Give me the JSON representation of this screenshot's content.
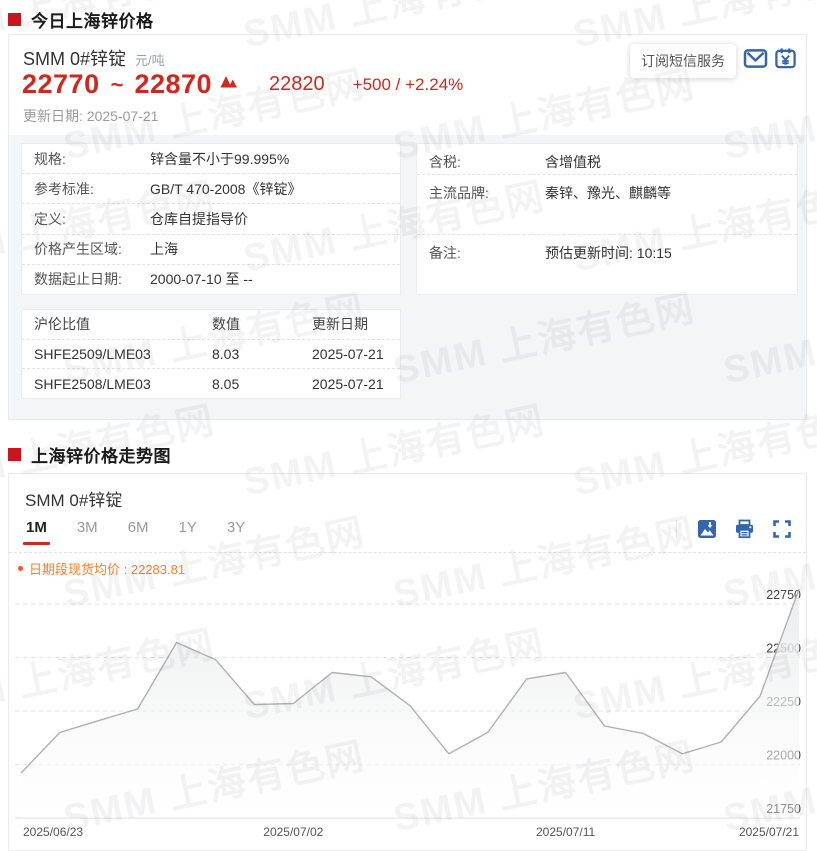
{
  "colors": {
    "accent_red": "#d0281e",
    "bullet_red": "#c9151e",
    "icon_blue": "#3566ad",
    "legend_orange": "#ff7d26",
    "legend_dot": "#fb4f2d",
    "chart_line_gray": "#b1b1b1"
  },
  "watermark": {
    "text": "SMM 上海有色网"
  },
  "sections": {
    "today_title": "今日上海锌价格",
    "trend_title": "上海锌价格走势图"
  },
  "quote": {
    "product": "SMM 0#锌锭",
    "unit": "元/吨",
    "price_low": "22770",
    "range_separator": "~",
    "price_high": "22870",
    "avg_price": "22820",
    "change": "+500 / +2.24%",
    "update_label": "更新日期:",
    "update_date": "2025-07-21",
    "subscribe_tooltip": "订阅短信服务"
  },
  "spec_table": {
    "rows": [
      {
        "label": "规格:",
        "value": "锌含量不小于99.995%"
      },
      {
        "label": "参考标准:",
        "value": "GB/T 470-2008《锌锭》"
      },
      {
        "label": "定义:",
        "value": "仓库自提指导价"
      },
      {
        "label": "价格产生区域:",
        "value": "上海"
      },
      {
        "label": "数据起止日期:",
        "value": "2000-07-10 至 --"
      }
    ]
  },
  "tax_table": {
    "rows": [
      {
        "label": "含税:",
        "value": "含增值税"
      },
      {
        "label": "主流品牌:",
        "value": "秦锌、豫光、麒麟等"
      },
      {
        "label": "备注:",
        "value": "预估更新时间: 10:15"
      }
    ]
  },
  "ratio_table": {
    "headers": [
      "沪伦比值",
      "数值",
      "更新日期"
    ],
    "rows": [
      [
        "SHFE2509/LME03",
        "8.03",
        "2025-07-21"
      ],
      [
        "SHFE2508/LME03",
        "8.05",
        "2025-07-21"
      ]
    ]
  },
  "chart_card": {
    "title": "SMM 0#锌锭",
    "tabs": [
      {
        "label": "1M",
        "active": true
      },
      {
        "label": "3M",
        "active": false
      },
      {
        "label": "6M",
        "active": false
      },
      {
        "label": "1Y",
        "active": false
      },
      {
        "label": "3Y",
        "active": false
      }
    ],
    "icons": [
      "save-image-icon",
      "print-icon",
      "fullscreen-icon"
    ],
    "legend_name": "日期段现货均价",
    "legend_separator": " : ",
    "legend_value": "22283.81"
  },
  "chart_data": {
    "type": "area",
    "title": "SMM 0#锌锭 价格走势 1M",
    "series_name": "日期段现货均价",
    "average": 22283.81,
    "x": [
      "2025/06/23",
      "2025/06/24",
      "2025/06/25",
      "2025/06/26",
      "2025/06/27",
      "2025/06/30",
      "2025/07/01",
      "2025/07/02",
      "2025/07/03",
      "2025/07/04",
      "2025/07/07",
      "2025/07/08",
      "2025/07/09",
      "2025/07/10",
      "2025/07/11",
      "2025/07/14",
      "2025/07/15",
      "2025/07/16",
      "2025/07/17",
      "2025/07/18",
      "2025/07/21"
    ],
    "values": [
      21960,
      22150,
      22205,
      22260,
      22570,
      22490,
      22280,
      22285,
      22430,
      22410,
      22275,
      22050,
      22150,
      22400,
      22430,
      22180,
      22145,
      22050,
      22105,
      22320,
      22820
    ],
    "ylim": [
      21750,
      22850
    ],
    "yticks": [
      21750,
      22000,
      22250,
      22500,
      22750
    ],
    "x_axis_labels": [
      "2025/06/23",
      "2025/07/02",
      "2025/07/11",
      "2025/07/21"
    ],
    "grid": "horizontal-dashed",
    "legend_position": "top-left",
    "xlabel": "",
    "ylabel": ""
  }
}
